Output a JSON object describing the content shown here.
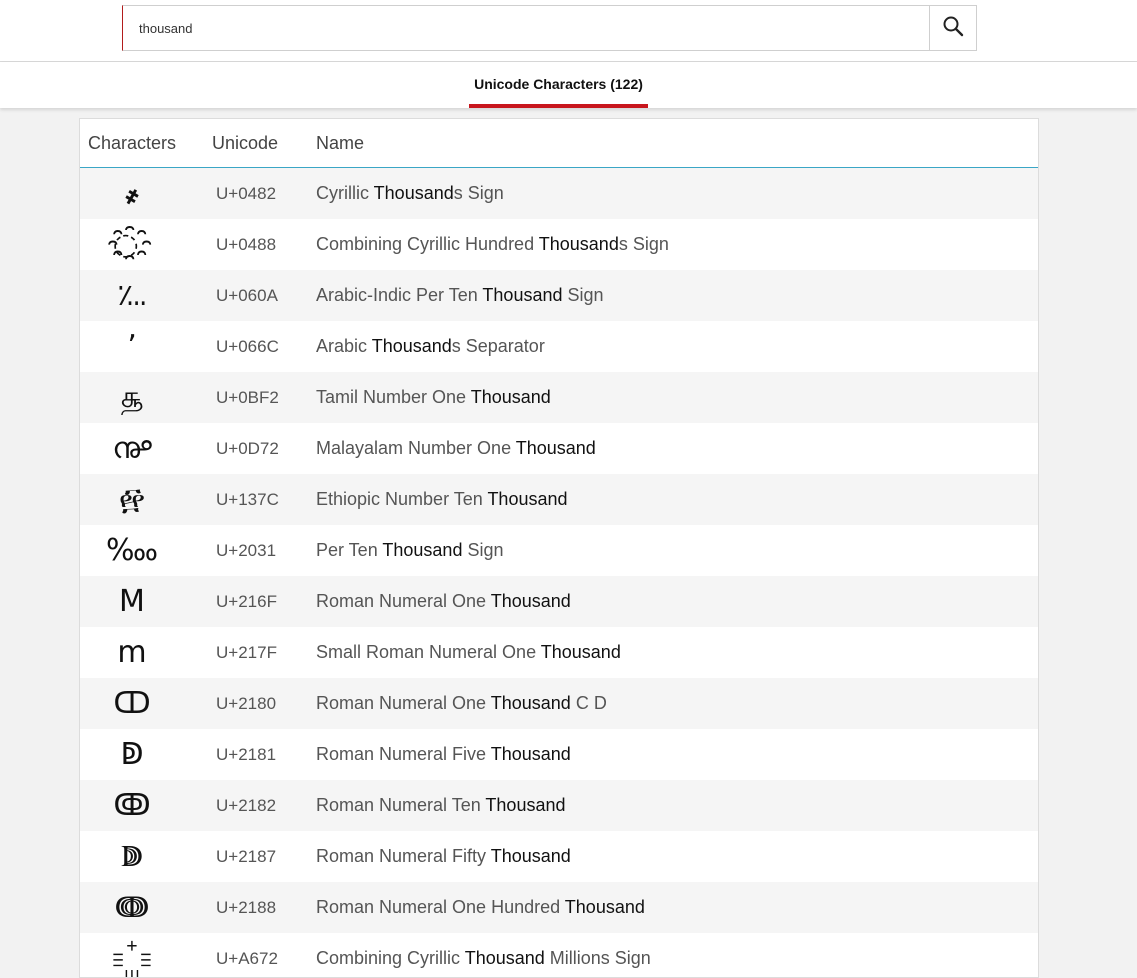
{
  "search": {
    "value": "thousand",
    "placeholder": ""
  },
  "tabs": [
    {
      "label": "Unicode Characters (122)",
      "active": true
    }
  ],
  "table": {
    "headers": {
      "characters": "Characters",
      "unicode": "Unicode",
      "name": "Name"
    },
    "rows": [
      {
        "char": "҂",
        "code": "U+0482",
        "name_pre": "Cyrillic ",
        "name_hl": "Thousand",
        "name_post": "s Sign"
      },
      {
        "char": "◌҈",
        "code": "U+0488",
        "name_pre": "Combining Cyrillic Hundred ",
        "name_hl": "Thousand",
        "name_post": "s Sign"
      },
      {
        "char": "؊",
        "code": "U+060A",
        "name_pre": "Arabic-Indic Per Ten ",
        "name_hl": "Thousand",
        "name_post": " Sign"
      },
      {
        "char": "٬",
        "code": "U+066C",
        "name_pre": "Arabic ",
        "name_hl": "Thousand",
        "name_post": "s Separator"
      },
      {
        "char": "௲",
        "code": "U+0BF2",
        "name_pre": "Tamil Number One ",
        "name_hl": "Thousand",
        "name_post": ""
      },
      {
        "char": "൲",
        "code": "U+0D72",
        "name_pre": "Malayalam Number One ",
        "name_hl": "Thousand",
        "name_post": ""
      },
      {
        "char": "፼",
        "code": "U+137C",
        "name_pre": "Ethiopic Number Ten ",
        "name_hl": "Thousand",
        "name_post": ""
      },
      {
        "char": "‱",
        "code": "U+2031",
        "name_pre": "Per Ten ",
        "name_hl": "Thousand",
        "name_post": " Sign"
      },
      {
        "char": "Ⅿ",
        "code": "U+216F",
        "name_pre": "Roman Numeral One ",
        "name_hl": "Thousand",
        "name_post": ""
      },
      {
        "char": "ⅿ",
        "code": "U+217F",
        "name_pre": "Small Roman Numeral One ",
        "name_hl": "Thousand",
        "name_post": ""
      },
      {
        "char": "ↀ",
        "code": "U+2180",
        "name_pre": "Roman Numeral One ",
        "name_hl": "Thousand",
        "name_post": " C D"
      },
      {
        "char": "ↁ",
        "code": "U+2181",
        "name_pre": "Roman Numeral Five ",
        "name_hl": "Thousand",
        "name_post": ""
      },
      {
        "char": "ↂ",
        "code": "U+2182",
        "name_pre": "Roman Numeral Ten ",
        "name_hl": "Thousand",
        "name_post": ""
      },
      {
        "char": "ↇ",
        "code": "U+2187",
        "name_pre": "Roman Numeral Fifty ",
        "name_hl": "Thousand",
        "name_post": ""
      },
      {
        "char": "ↈ",
        "code": "U+2188",
        "name_pre": "Roman Numeral One Hundred ",
        "name_hl": "Thousand",
        "name_post": ""
      },
      {
        "char": "꙲",
        "code": "U+A672",
        "name_pre": "Combining Cyrillic ",
        "name_hl": "Thousand",
        "name_post": " Millions Sign"
      }
    ]
  },
  "colors": {
    "accent": "#c8161d",
    "header_rule": "#3aa6c6"
  }
}
